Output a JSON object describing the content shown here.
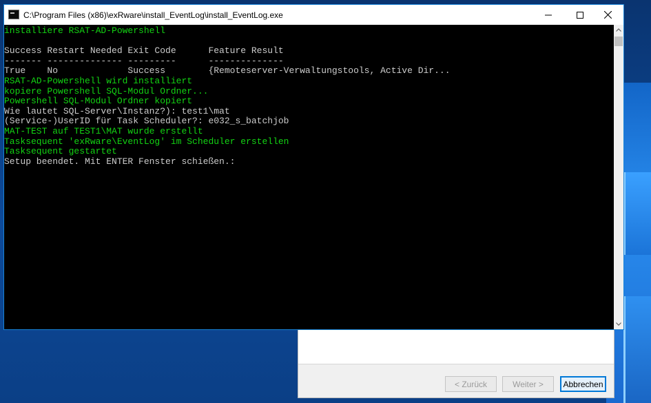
{
  "window": {
    "title": "C:\\Program Files (x86)\\exRware\\install_EventLog\\install_EventLog.exe",
    "icon": "console-icon",
    "controls": [
      "minimize-icon",
      "maximize-icon",
      "close-icon"
    ]
  },
  "console": {
    "background": "#000000",
    "colors": {
      "green": "#13d313",
      "gray": "#cccccc"
    },
    "lines": [
      {
        "text": "installiere RSAT-AD-Powershell",
        "color": "green"
      },
      {
        "text": "",
        "color": "gray"
      },
      {
        "text": "Success Restart Needed Exit Code      Feature Result",
        "color": "gray"
      },
      {
        "text": "------- -------------- ---------      --------------",
        "color": "gray"
      },
      {
        "text": "True    No             Success        {Remoteserver-Verwaltungstools, Active Dir...",
        "color": "gray"
      },
      {
        "text": "RSAT-AD-Powershell wird installiert",
        "color": "green"
      },
      {
        "text": "kopiere Powershell SQL-Modul Ordner...",
        "color": "green"
      },
      {
        "text": "Powershell SQL-Modul Ordner kopiert",
        "color": "green"
      },
      {
        "text": "Wie lautet SQL-Server\\Instanz?): test1\\mat",
        "color": "gray"
      },
      {
        "text": "(Service-)UserID für Task Scheduler?: e032_s_batchjob",
        "color": "gray"
      },
      {
        "text": "MAT-TEST auf TEST1\\MAT wurde erstellt",
        "color": "green"
      },
      {
        "text": "Tasksequent 'exRware\\EventLog' im Scheduler erstellen",
        "color": "green"
      },
      {
        "text": "Tasksequent gestartet",
        "color": "green"
      },
      {
        "text": "Setup beendet. Mit ENTER Fenster schießen.:",
        "color": "gray"
      }
    ]
  },
  "wizard": {
    "back_label": "< Zurück",
    "next_label": "Weiter >",
    "cancel_label": "Abbrechen"
  }
}
